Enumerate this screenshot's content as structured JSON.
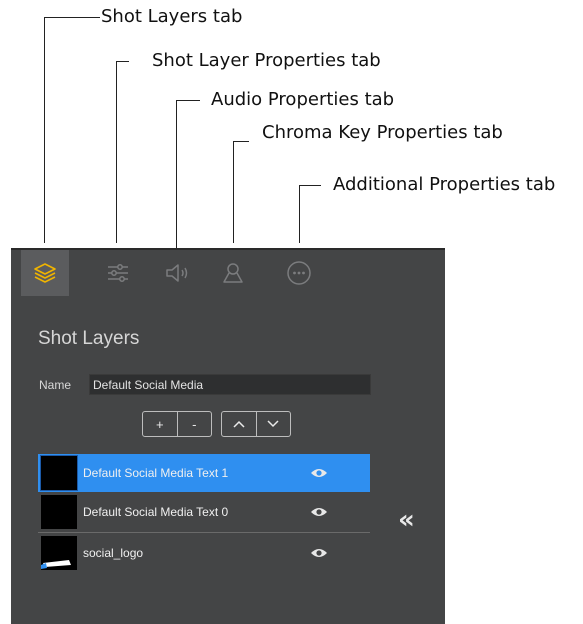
{
  "callouts": {
    "shot_layers_tab": "Shot Layers tab",
    "shot_layer_properties_tab": "Shot Layer Properties tab",
    "audio_properties_tab": "Audio Properties tab",
    "chroma_key_properties_tab": "Chroma Key Properties tab",
    "additional_properties_tab": "Additional Properties tab"
  },
  "tabs": [
    {
      "icon": "layers-icon",
      "active": true
    },
    {
      "icon": "sliders-icon",
      "active": false
    },
    {
      "icon": "speaker-icon",
      "active": false
    },
    {
      "icon": "person-icon",
      "active": false
    },
    {
      "icon": "more-icon",
      "active": false
    }
  ],
  "section": {
    "title": "Shot Layers"
  },
  "name_field": {
    "label": "Name",
    "value": "Default Social Media"
  },
  "buttons": {
    "add": "+",
    "remove": "-",
    "move_up": "^",
    "move_down": "v"
  },
  "layers": [
    {
      "name": "Default Social Media Text 1",
      "selected": true,
      "visible": true
    },
    {
      "name": "Default Social Media Text 0",
      "selected": false,
      "visible": true
    },
    {
      "name": "social_logo",
      "selected": false,
      "visible": true
    }
  ],
  "collapse_label": "«",
  "colors": {
    "accent": "#f0b400",
    "selection": "#2f8ff0",
    "panel": "#444546"
  }
}
